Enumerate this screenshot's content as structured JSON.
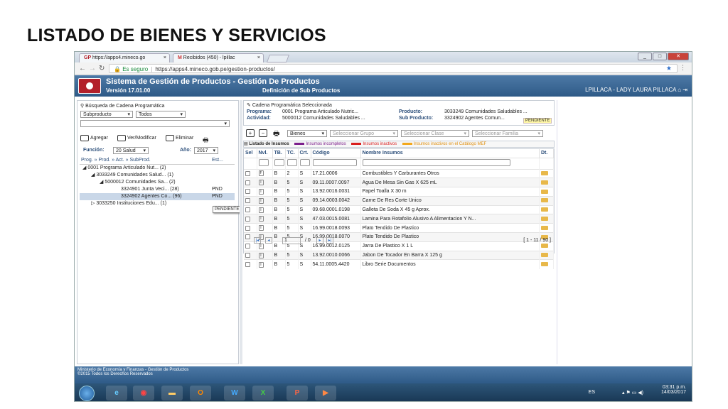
{
  "slide_title": "LISTADO DE BIENES Y SERVICIOS",
  "browser": {
    "tab1": "https://apps4.mineco.go",
    "tab2": "Recibidos (450) - lpillac",
    "tab_close": "×",
    "secure_label": "Es seguro",
    "url": "https://apps4.mineco.gob.pe/gestion-productos/"
  },
  "app": {
    "title": "Sistema de Gestión de Productos - Gestión De Productos",
    "version": "Versión 17.01.00",
    "subtitle": "Definición de Sub Productos",
    "user": "LPILLACA - LADY LAURA PILLACA"
  },
  "left": {
    "search_heading": "Búsqueda de Cadena Programática",
    "filter1": "Subproducto",
    "filter2": "Todos",
    "btn_add": "Agregar",
    "btn_view": "Ver/Modificar",
    "btn_delete": "Eliminar",
    "funcion_label": "Función:",
    "funcion_value": "20 Salud",
    "anio_label": "Año:",
    "anio_value": "2017",
    "tree_col1": "Prog. » Prod. » Act. » SubProd.",
    "tree_col2": "Est...",
    "tree": [
      {
        "text": "◢  0001 Programa Articulado Nut... (2)",
        "status": ""
      },
      {
        "text": "◢  3033249 Comunidades Salud... (1)",
        "status": ""
      },
      {
        "text": "◢  5000012 Comunidades Sa... (2)",
        "status": ""
      },
      {
        "text": "3324901 Junta Veci... (28)",
        "status": "PND"
      },
      {
        "text": "3324902 Agentes Co... (96)",
        "status": "PND"
      },
      {
        "text": "▷  3033250 Instituciones Edu... (1)",
        "status": ""
      }
    ],
    "tooltip": "PENDIENTE"
  },
  "cadena": {
    "heading": "Cadena Programática Seleccionada",
    "programa_label": "Programa:",
    "programa_value": "0001 Programa Articulado Nutric...",
    "producto_label": "Producto:",
    "producto_value": "3033249 Comunidades Saludables ...",
    "actividad_label": "Actividad:",
    "actividad_value": "5000012 Comunidades Saludables ...",
    "subproducto_label": "Sub Producto:",
    "subproducto_value": "3324902 Agentes Comun...",
    "badge": "PENDIENTE"
  },
  "toolbar": {
    "type_select": "Bienes",
    "grupo_placeholder": "Seleccionar Grupo",
    "clase_placeholder": "Seleccionar Clase",
    "familia_placeholder": "Seleccionar Familia"
  },
  "legend": {
    "title": "Listado de Insumos",
    "item1": "Insumos incompletos",
    "item2": "Insumos inactivos",
    "item3": "Insumos inactivos en el Catálogo MEF",
    "color1": "#7b1f8c",
    "color2": "#d91f1f",
    "color3": "#f2a81d"
  },
  "grid": {
    "columns": [
      "Sel",
      "Nvl.",
      "TB.",
      "TC.",
      "Crt.",
      "Código",
      "Nombre Insumos",
      "Dt."
    ],
    "rows": [
      {
        "nvl": "F",
        "tb": "B",
        "tc": "2",
        "crt": "S",
        "codigo": "17.21.0006",
        "nombre": "Combustibles Y Carburantes Otros"
      },
      {
        "nvl": "I",
        "tb": "B",
        "tc": "5",
        "crt": "S",
        "codigo": "09.11.0007.0097",
        "nombre": "Agua De Mesa Sin Gas X 625 mL"
      },
      {
        "nvl": "I",
        "tb": "B",
        "tc": "5",
        "crt": "S",
        "codigo": "13.92.0016.0031",
        "nombre": "Papel Toalla X 30 m"
      },
      {
        "nvl": "I",
        "tb": "B",
        "tc": "5",
        "crt": "S",
        "codigo": "09.14.0003.0042",
        "nombre": "Carne De Res Corte Unico"
      },
      {
        "nvl": "I",
        "tb": "B",
        "tc": "5",
        "crt": "S",
        "codigo": "09.68.0001.0198",
        "nombre": "Galleta De Soda X 45 g Aprox."
      },
      {
        "nvl": "I",
        "tb": "B",
        "tc": "5",
        "crt": "S",
        "codigo": "47.03.0015.0081",
        "nombre": "Lamina Para Rotafolio Alusivo A Alimentacion Y N..."
      },
      {
        "nvl": "I",
        "tb": "B",
        "tc": "5",
        "crt": "S",
        "codigo": "16.99.0018.0093",
        "nombre": "Plato Tendido De Plastico"
      },
      {
        "nvl": "I",
        "tb": "B",
        "tc": "5",
        "crt": "S",
        "codigo": "16.99.0018.0070",
        "nombre": "Plato Tendido De Plastico"
      },
      {
        "nvl": "I",
        "tb": "B",
        "tc": "5",
        "crt": "S",
        "codigo": "16.99.0012.0125",
        "nombre": "Jarra De Plastico X 1 L"
      },
      {
        "nvl": "I",
        "tb": "B",
        "tc": "5",
        "crt": "S",
        "codigo": "13.92.0010.0066",
        "nombre": "Jabon De Tocador En Barra X 125 g"
      },
      {
        "nvl": "I",
        "tb": "B",
        "tc": "5",
        "crt": "S",
        "codigo": "54.11.0005.4420",
        "nombre": "Libro Serie Documentos"
      }
    ],
    "page_value": "1",
    "page_total": "/ 0",
    "range": "[ 1 - 11 / 90 ]"
  },
  "footer": {
    "line1": "Ministerio de Economía y Finanzas - Gestión de Productos",
    "line2": "©2015 Todos los Derechos Reservados"
  },
  "taskbar": {
    "lang": "ES",
    "time": "03:31 p.m.",
    "date": "14/03/2017"
  }
}
